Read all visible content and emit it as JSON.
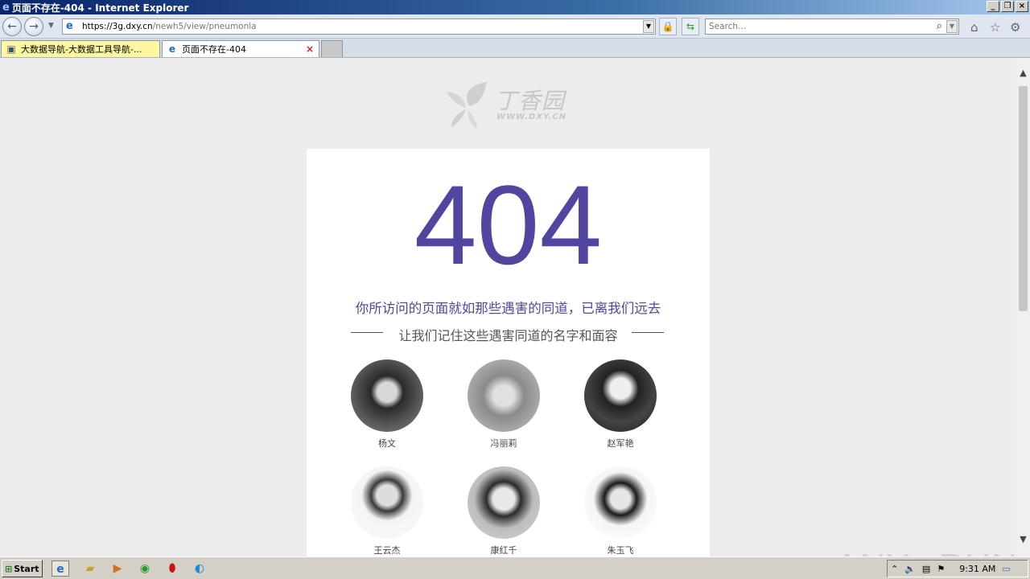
{
  "window": {
    "title": "页面不存在-404 - Internet Explorer"
  },
  "nav": {
    "url_host": "https://3g.dxy.cn",
    "url_path": "/newh5/view/pneumonia",
    "search_placeholder": "Search..."
  },
  "tabs": [
    {
      "label": "大数据导航-大数据工具导航-...",
      "active": false
    },
    {
      "label": "页面不存在-404",
      "active": true
    }
  ],
  "page": {
    "logo_name": "丁香园",
    "logo_url": "WWW.DXY.CN",
    "code": "404",
    "message": "你所访问的页面就如那些遇害的同道，已离我们远去",
    "sub_message": "让我们记住这些遇害同道的名字和面容",
    "people": [
      {
        "name": "杨文"
      },
      {
        "name": "冯丽莉"
      },
      {
        "name": "赵军艳"
      },
      {
        "name": "王云杰"
      },
      {
        "name": "康红千"
      },
      {
        "name": "朱玉飞"
      }
    ]
  },
  "taskbar": {
    "start_label": "Start",
    "clock": "9:31 AM"
  },
  "watermark": "ANY▷RUN"
}
